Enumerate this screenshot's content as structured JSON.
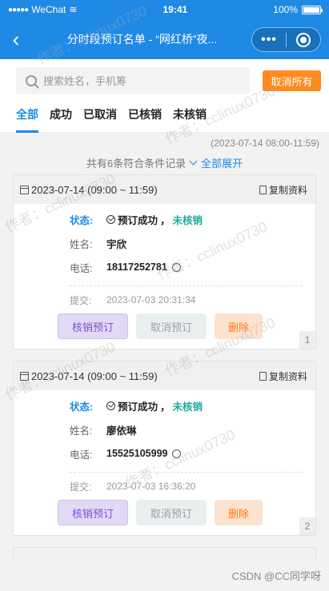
{
  "status_bar": {
    "carrier": "WeChat",
    "time": "19:41",
    "battery": "100%"
  },
  "navbar": {
    "title": "分时段预订名单 - “网红桥”夜...",
    "more": "•••"
  },
  "search": {
    "placeholder": "搜索姓名，手机筹"
  },
  "cancel_all_label": "取消所有",
  "tabs": [
    "全部",
    "成功",
    "已取消",
    "已核销",
    "未核销"
  ],
  "active_tab": "全部",
  "range": "(2023-07-14 08:00-11:59)",
  "summary": {
    "count_text": "共有6条符合条件记录",
    "expand_label": "全部展开"
  },
  "labels": {
    "status": "状态:",
    "name": "姓名:",
    "phone": "电话:",
    "submit": "提交:",
    "copy": "复制资料",
    "unverified": "未核销",
    "status_value": "预订成功",
    "separator": "，"
  },
  "buttons": {
    "verify": "核销预订",
    "cancel": "取消预订",
    "delete": "删除"
  },
  "records": [
    {
      "date": "2023-07-14 (09:00 ~ 11:59)",
      "name": "宇欣",
      "phone": "18117252781",
      "submitted": "2023-07-03 20:31:34",
      "index": "1"
    },
    {
      "date": "2023-07-14 (09:00 ~ 11:59)",
      "name": "廖依琳",
      "phone": "15525105999",
      "submitted": "2023-07-03 16:36:20",
      "index": "2"
    }
  ],
  "watermark_text": "作者：cclinux0730",
  "credit": "CSDN @CC同学呀",
  "colors": {
    "primary": "#1f8ae6",
    "orange": "#ff8a1f",
    "teal": "#1faa9a",
    "purple": "#7c4fd8"
  }
}
